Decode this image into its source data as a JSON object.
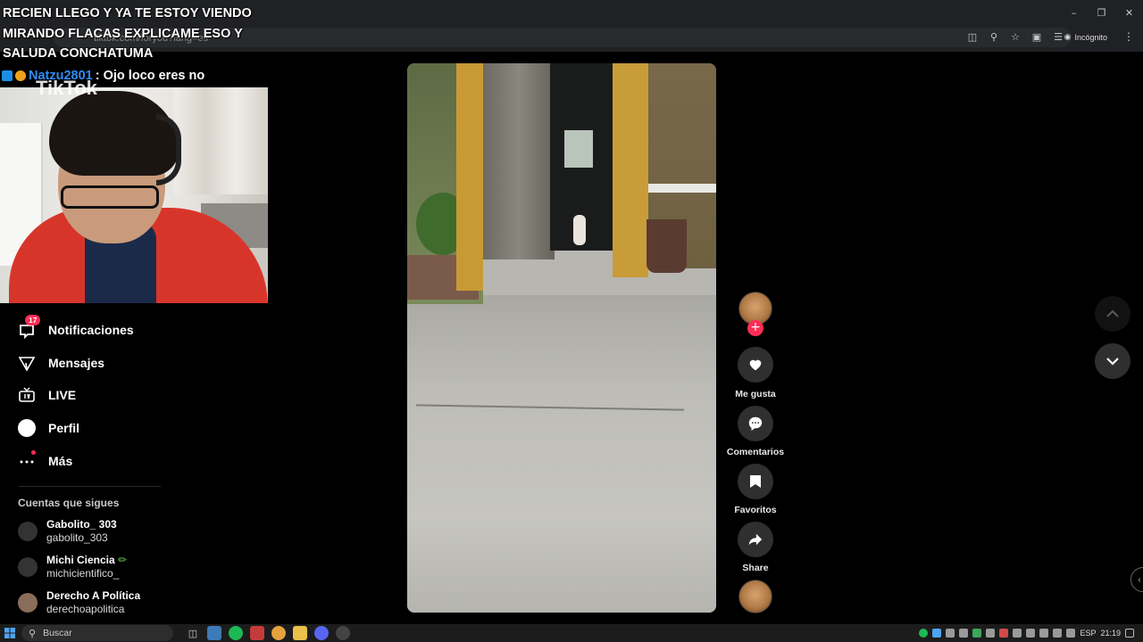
{
  "browser": {
    "url": "tiktok.com/foryou?lang=es",
    "incognito_label": "Incógnito"
  },
  "stream": {
    "overlay_title": "RECIEN LLEGO Y YA TE ESTOY VIENDO MIRANDO FLACAS EXPLICAME ESO Y SALUDA CONCHATUMA",
    "chat_user": "Natzu2801",
    "chat_message": ": Ojo loco eres no",
    "watermark": "TikTok"
  },
  "sidebar": {
    "items": [
      {
        "label": "Notificaciones",
        "icon": "inbox-icon",
        "badge": "17"
      },
      {
        "label": "Mensajes",
        "icon": "paper-plane-icon"
      },
      {
        "label": "LIVE",
        "icon": "tv-icon"
      },
      {
        "label": "Perfil",
        "icon": "profile-icon"
      },
      {
        "label": "Más",
        "icon": "more-icon"
      }
    ],
    "following_title": "Cuentas que sigues",
    "following": [
      {
        "name": "Gabolito_ 303",
        "handle": "gabolito_303"
      },
      {
        "name": "Michi Ciencia",
        "handle": "michicientifico_"
      },
      {
        "name": "Derecho A Política",
        "handle": "derechoapolitica"
      }
    ]
  },
  "actions": {
    "like_label": "Me gusta",
    "comments_label": "Comentarios",
    "favorites_label": "Favoritos",
    "share_label": "Share"
  },
  "taskbar": {
    "search_placeholder": "Buscar",
    "language": "ESP",
    "time": "21:19"
  },
  "colors": {
    "accent": "#fe2c55",
    "chat_user": "#2f8cf5",
    "background": "#000000"
  }
}
